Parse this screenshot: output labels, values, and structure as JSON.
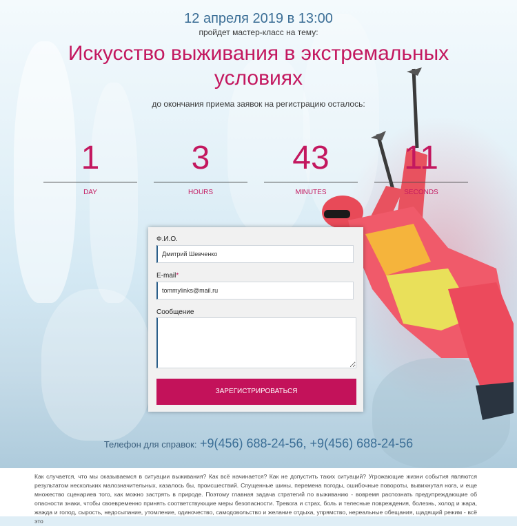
{
  "header": {
    "date": "12 апреля 2019 в 13:00",
    "date_sub": "пройдет мастер-класс на тему:",
    "title": "Искусство выживания в экстремальных условиях",
    "deadline": "до окончания приема заявок на регистрацию осталось:"
  },
  "timer": [
    {
      "value": "1",
      "label": "DAY"
    },
    {
      "value": "3",
      "label": "HOURS"
    },
    {
      "value": "43",
      "label": "MINUTES"
    },
    {
      "value": "11",
      "label": "SECONDS"
    }
  ],
  "form": {
    "name_label": "Ф.И.О.",
    "name_value": "Дмитрий Шевченко",
    "email_label": "E-mail",
    "email_required": "*",
    "email_value": "tommylinks@mail.ru",
    "message_label": "Сообщение",
    "message_value": "",
    "submit_label": "ЗАРЕГИСТРИРОВАТЬСЯ"
  },
  "contact": {
    "phone_label": "Телефон для справок:",
    "phones": "+9(456) 688-24-56, +9(456) 688-24-56"
  },
  "article": {
    "text": "Как случается, что мы оказываемся в ситуации выживания? Как всё начинается? Как не допустить таких ситуаций? Угрожающие жизни события являются результатом нескольких малозначительных, казалось бы, происшествий. Спущенные шины, перемена погоды, ошибочные повороты, вывихнутая нога, и еще множество сценариев того, как можно застрять в природе. Поэтому главная задача стратегий по выживанию - вовремя распознать предупреждающие об опасности знаки, чтобы своевременно принять соответствующие меры безопасности. Тревога и страх, боль и телесные повреждения, болезнь, холод и жара, жажда и голод, сырость, недосыпание, утомление, одиночество, самодовольство и желание отдыха, упрямство, нереальные обещания, щадящий режим - всё это"
  },
  "colors": {
    "accent": "#c3185f",
    "blue": "#3b6e96"
  }
}
